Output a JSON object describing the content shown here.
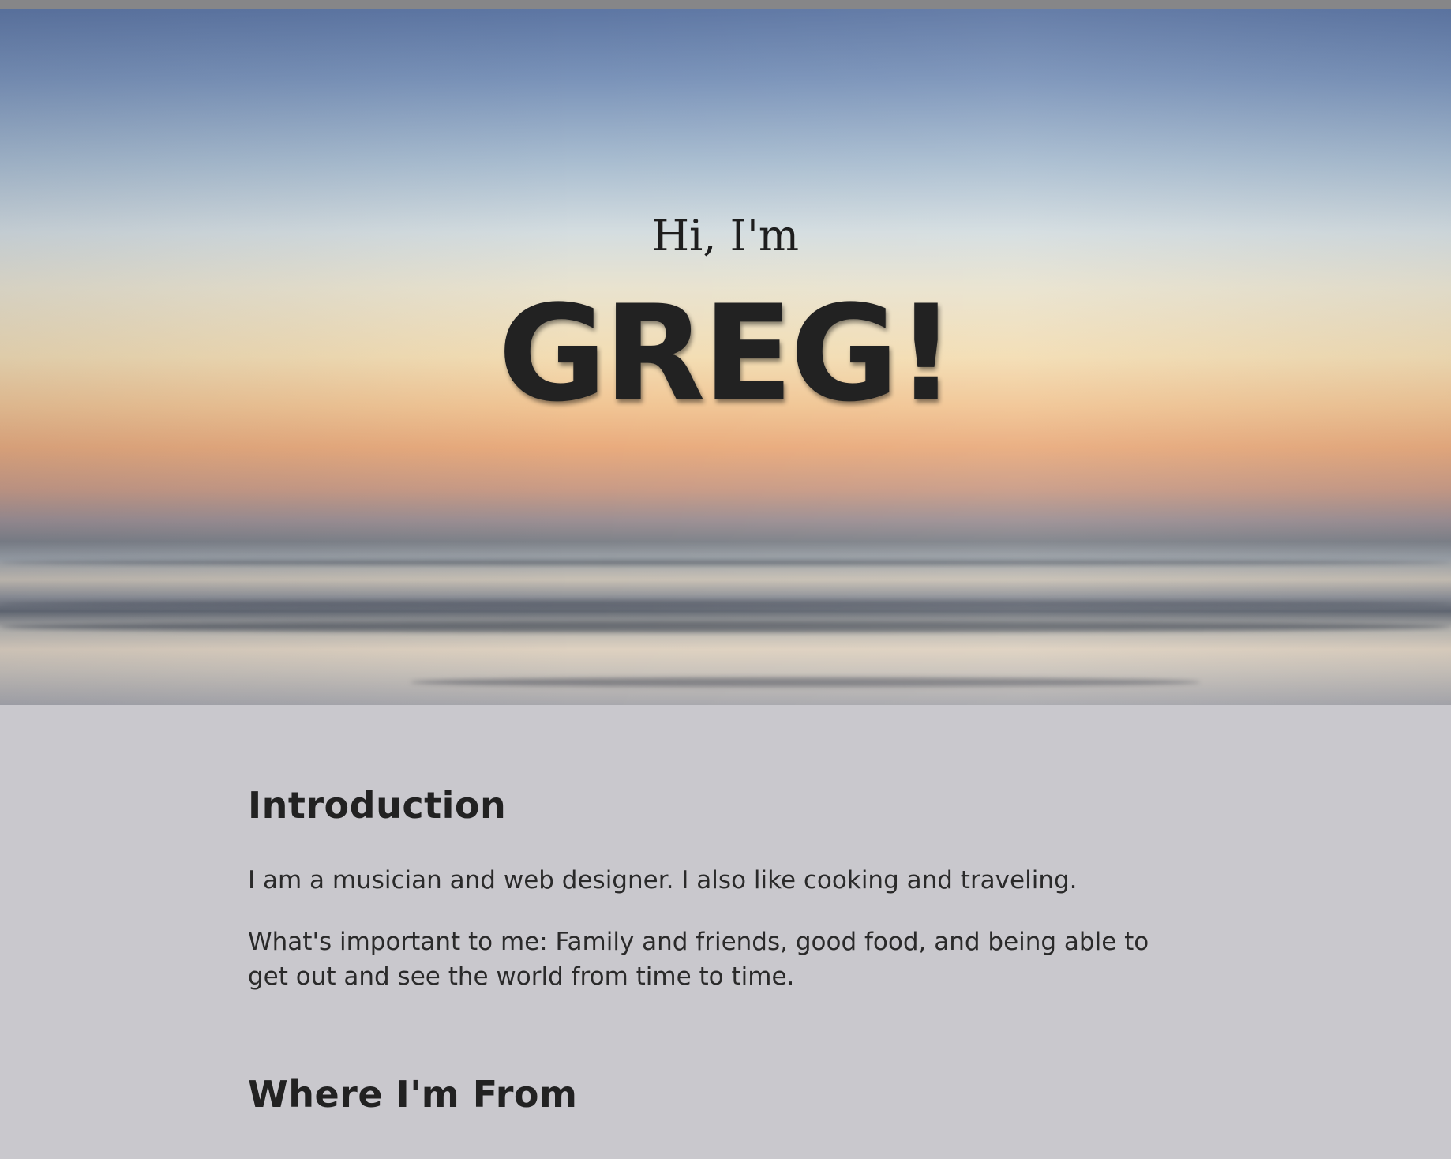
{
  "hero": {
    "greeting": "Hi, I'm",
    "name": "GREG!"
  },
  "sections": {
    "introduction": {
      "heading": "Introduction",
      "paragraphs": [
        "I am a musician and web designer. I also like cooking and traveling.",
        "What's important to me: Family and friends, good food, and being able to get out and see the world from time to time."
      ]
    },
    "where_from": {
      "heading": "Where I'm From"
    }
  },
  "colors": {
    "page_background": "#c9c8cd",
    "text": "#222222",
    "top_bar": "#868688"
  }
}
